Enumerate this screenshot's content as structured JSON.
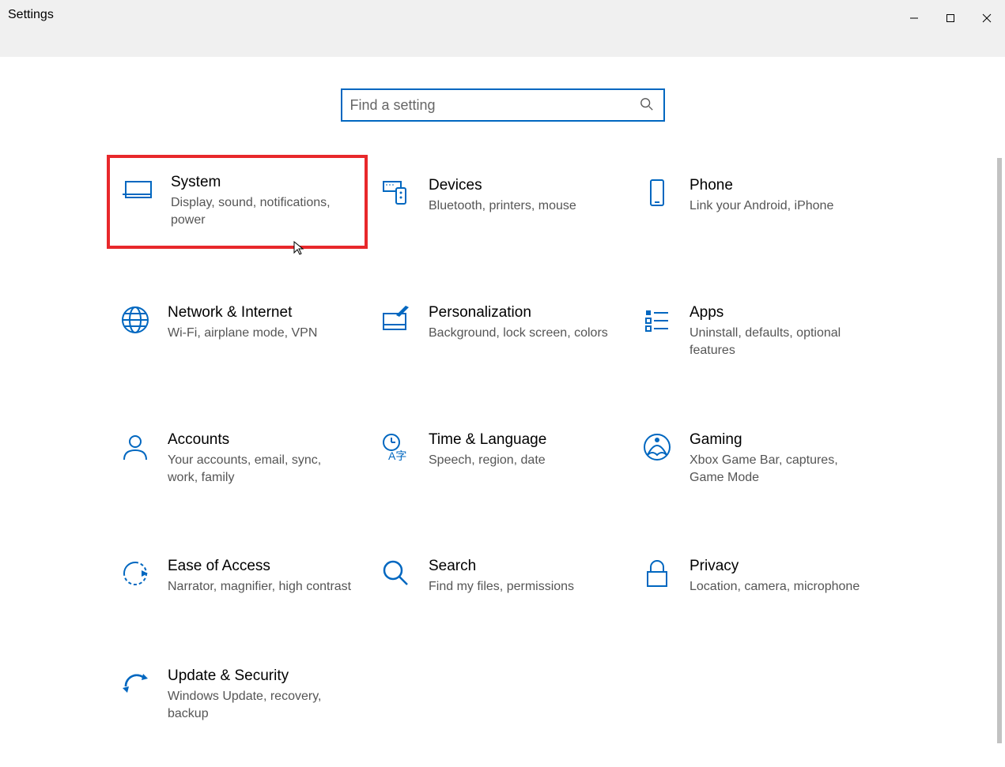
{
  "window": {
    "title": "Settings"
  },
  "search": {
    "placeholder": "Find a setting"
  },
  "categories": [
    {
      "id": "system",
      "title": "System",
      "desc": "Display, sound, notifications, power",
      "highlighted": true
    },
    {
      "id": "devices",
      "title": "Devices",
      "desc": "Bluetooth, printers, mouse"
    },
    {
      "id": "phone",
      "title": "Phone",
      "desc": "Link your Android, iPhone"
    },
    {
      "id": "network",
      "title": "Network & Internet",
      "desc": "Wi-Fi, airplane mode, VPN"
    },
    {
      "id": "personalization",
      "title": "Personalization",
      "desc": "Background, lock screen, colors"
    },
    {
      "id": "apps",
      "title": "Apps",
      "desc": "Uninstall, defaults, optional features"
    },
    {
      "id": "accounts",
      "title": "Accounts",
      "desc": "Your accounts, email, sync, work, family"
    },
    {
      "id": "time",
      "title": "Time & Language",
      "desc": "Speech, region, date"
    },
    {
      "id": "gaming",
      "title": "Gaming",
      "desc": "Xbox Game Bar, captures, Game Mode"
    },
    {
      "id": "ease",
      "title": "Ease of Access",
      "desc": "Narrator, magnifier, high contrast"
    },
    {
      "id": "search",
      "title": "Search",
      "desc": "Find my files, permissions"
    },
    {
      "id": "privacy",
      "title": "Privacy",
      "desc": "Location, camera, microphone"
    },
    {
      "id": "update",
      "title": "Update & Security",
      "desc": "Windows Update, recovery, backup"
    }
  ]
}
